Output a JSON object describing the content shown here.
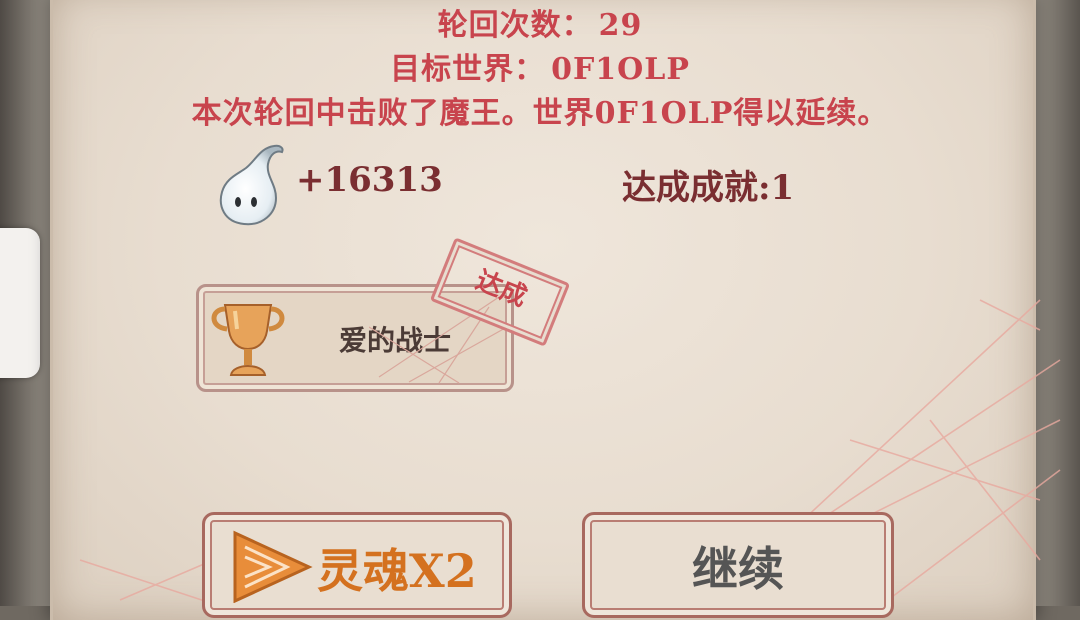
{
  "run_info": {
    "cycle_label": "轮回次数：",
    "cycle_value": "29",
    "world_label": "目标世界：",
    "world_value": "0F1OLP",
    "result_text": "本次轮回中击败了魔王。世界0F1OLP得以延续。"
  },
  "rewards": {
    "soul_amount": "+16313",
    "achievements_text": "达成成就:1"
  },
  "achievement": {
    "name": "爱的战士",
    "stamp": "达成"
  },
  "buttons": {
    "soul_double": "灵魂X2",
    "continue": "继续"
  },
  "icons": [
    "ghost-soul-icon",
    "trophy-icon",
    "play-triangle-icon"
  ],
  "colors": {
    "title_red": "#c8444d",
    "dark_red": "#7a2e31",
    "orange": "#d4711f",
    "parchment": "#e8ddd0"
  }
}
